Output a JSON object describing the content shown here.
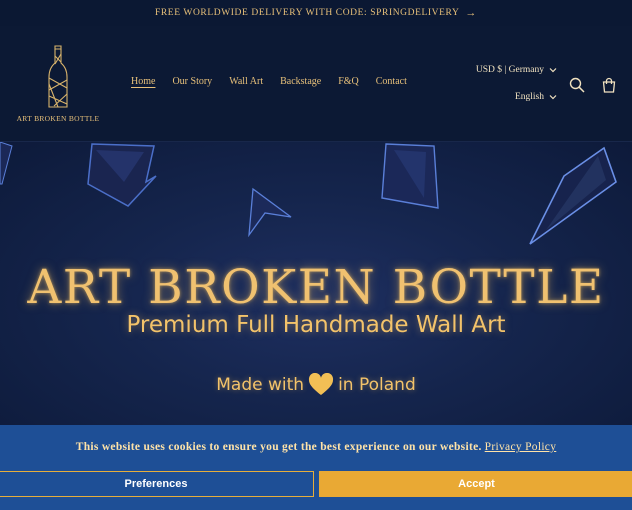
{
  "announcement": {
    "text": "FREE WORLDWIDE DELIVERY WITH CODE: SPRINGDELIVERY",
    "arrow": "→"
  },
  "brand": {
    "name": "ART BROKEN BOTTLE"
  },
  "nav": {
    "items": [
      {
        "label": "Home",
        "active": true
      },
      {
        "label": "Our Story"
      },
      {
        "label": "Wall Art"
      },
      {
        "label": "Backstage"
      },
      {
        "label": "F&Q"
      },
      {
        "label": "Contact"
      }
    ]
  },
  "locale": {
    "currency": "USD $ | Germany",
    "language": "English"
  },
  "icons": {
    "search": "search-icon",
    "cart": "cart-icon",
    "chevron": "chevron-down-icon",
    "heart": "heart-icon"
  },
  "hero": {
    "title": "ART BROKEN BOTTLE",
    "subtitle": "Premium Full Handmade Wall Art",
    "tagline_before": "Made with",
    "tagline_after": "in Poland"
  },
  "cookie": {
    "message": "This website uses cookies to ensure you get the best experience on our website.",
    "policy_link": "Privacy Policy",
    "preferences_label": "Preferences",
    "accept_label": "Accept"
  },
  "colors": {
    "gold": "#e7c07a",
    "navy": "#0b1833",
    "cookie_blue": "#1e4f96",
    "accept_orange": "#e9a934"
  }
}
